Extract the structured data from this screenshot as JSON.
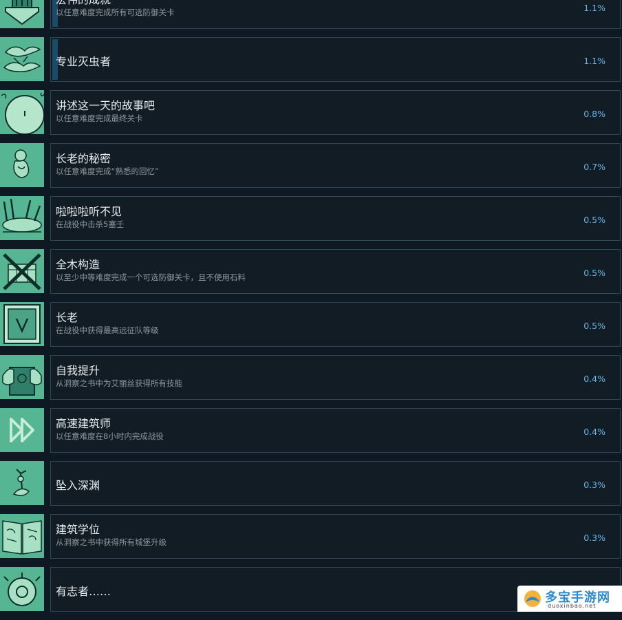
{
  "achievements": [
    {
      "title": "宏伟的成就",
      "desc": "以任意难度完成所有可选防御关卡",
      "percent": "1.1%",
      "icon": "trophy-pedestal-icon",
      "progress": 0.011
    },
    {
      "title": "专业灭虫者",
      "desc": "",
      "percent": "1.1%",
      "icon": "flying-creatures-icon",
      "progress": 0.011
    },
    {
      "title": "讲述这一天的故事吧",
      "desc": "以任意难度完成最终关卡",
      "percent": "0.8%",
      "icon": "round-clock-icon"
    },
    {
      "title": "长老的秘密",
      "desc": "以任意难度完成“熟悉的回忆”",
      "percent": "0.7%",
      "icon": "curled-figure-icon"
    },
    {
      "title": "啦啦啦听不见",
      "desc": "在战役中击杀5塞壬",
      "percent": "0.5%",
      "icon": "siren-creature-icon"
    },
    {
      "title": "全木构造",
      "desc": "以至少中等难度完成一个可选防御关卡，且不使用石料",
      "percent": "0.5%",
      "icon": "crossed-stone-icon"
    },
    {
      "title": "长老",
      "desc": "在战役中获得最高远征队等级",
      "percent": "0.5%",
      "icon": "rank-v-badge-icon"
    },
    {
      "title": "自我提升",
      "desc": "从洞察之书中为艾丽丝获得所有技能",
      "percent": "0.4%",
      "icon": "hands-holding-book-icon"
    },
    {
      "title": "高速建筑师",
      "desc": "以任意难度在8小时内完成战役",
      "percent": "0.4%",
      "icon": "fast-forward-icon"
    },
    {
      "title": "坠入深渊",
      "desc": "",
      "percent": "0.3%",
      "icon": "falling-figure-icon"
    },
    {
      "title": "建筑学位",
      "desc": "从洞察之书中获得所有城堡升级",
      "percent": "0.3%",
      "icon": "open-book-icon"
    },
    {
      "title": "有志者……",
      "desc": "",
      "percent": "",
      "icon": "gear-helmet-icon"
    }
  ],
  "watermark": {
    "main": "多宝手游网",
    "sub": "duoxinbao.net"
  },
  "colors": {
    "icon_bg": "#56b694",
    "card_bg": "#111c25",
    "card_border": "#2a4755",
    "percent": "#66b6e8",
    "title": "#e8edf1",
    "desc": "#8f98a0"
  }
}
